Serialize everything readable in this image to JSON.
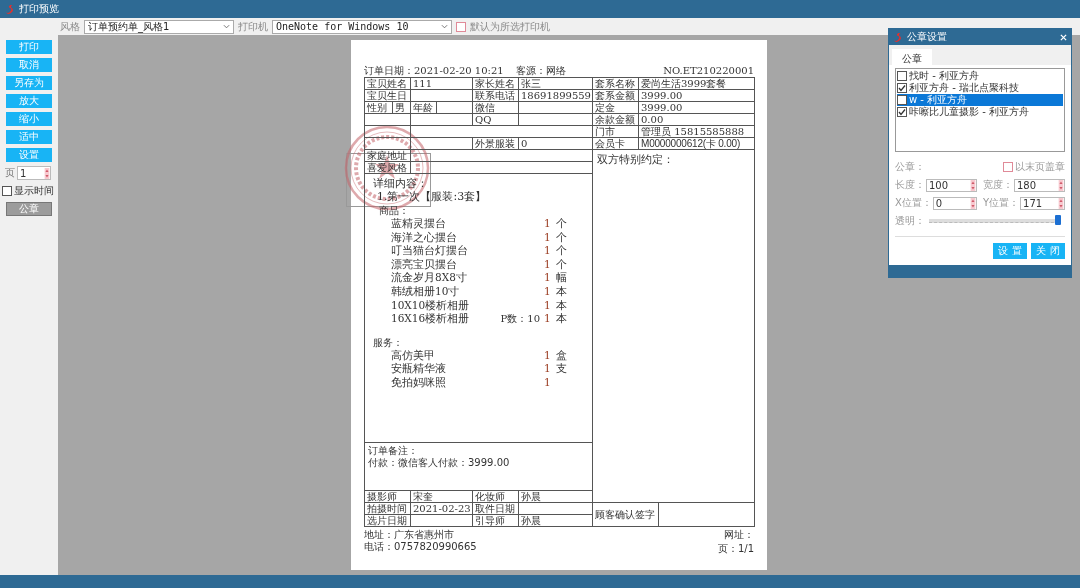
{
  "window": {
    "title": "打印预览"
  },
  "toolbar": {
    "style_label": "风格",
    "style_value": "订单预约单_风格1",
    "printer_label": "打印机",
    "printer_value": "OneNote for Windows 10",
    "default_printer": {
      "label": "默认为所选打印机",
      "checked": false
    }
  },
  "sidebar": {
    "buttons": [
      {
        "label": "打印"
      },
      {
        "label": "取消"
      },
      {
        "label": "另存为"
      },
      {
        "label": "放大"
      },
      {
        "label": "缩小"
      },
      {
        "label": "适中"
      },
      {
        "label": "设置"
      }
    ],
    "page": {
      "label": "页",
      "value": "1"
    },
    "show_time": {
      "label": "显示时间",
      "checked": false
    },
    "seal_button": "公章"
  },
  "document": {
    "header": {
      "order_date": "订单日期：2021-02-20 10:21",
      "source": "客源：网络",
      "number": "NO.ET210220001"
    },
    "info_rows": [
      {
        "kind": "four",
        "label1": "宝贝姓名",
        "value1": "111",
        "label2": "家长姓名",
        "value2": "张三"
      },
      {
        "kind": "four",
        "label1": "宝贝生日",
        "label2": "联系电话",
        "value2": "18691899559"
      },
      {
        "kind": "split",
        "label1": "性别",
        "sub1": "男",
        "mid": "年龄",
        "label2": "微信"
      },
      {
        "kind": "four",
        "label2": "QQ"
      },
      {
        "kind": "wide"
      },
      {
        "kind": "four",
        "label2": "外景服装",
        "value2": "0"
      },
      {
        "kind": "wide",
        "label1": "家庭地址"
      },
      {
        "kind": "wide",
        "label1": "喜爱风格"
      }
    ],
    "package_rows": [
      {
        "label": "套系名称",
        "value": "爱尚生活3999套餐"
      },
      {
        "label": "套系金额",
        "value": "3999.00"
      },
      {
        "label": "定金",
        "value": "3999.00"
      },
      {
        "label": "余款金额",
        "value": "0.00"
      },
      {
        "label": "门市",
        "value": "管理员  15815585888"
      },
      {
        "label": "会员卡",
        "value": "M0000000612(卡 0.00)",
        "kind": "small"
      }
    ],
    "details": {
      "title": "详细内容：",
      "package": "1.第一次【服装:3套】",
      "sections": [
        {
          "title": "商品：",
          "items": [
            {
              "name": "蓝精灵摆台",
              "qty": "1",
              "unit": "个"
            },
            {
              "name": "海洋之心摆台",
              "qty": "1",
              "unit": "个"
            },
            {
              "name": "叮当猫台灯摆台",
              "qty": "1",
              "unit": "个"
            },
            {
              "name": "漂亮宝贝摆台",
              "qty": "1",
              "unit": "个"
            },
            {
              "name": "流金岁月8X8寸",
              "qty": "1",
              "unit": "幅"
            },
            {
              "name": "韩绒相册10寸",
              "qty": "1",
              "unit": "本"
            },
            {
              "name": "10X10楼析相册",
              "qty": "1",
              "unit": "本"
            },
            {
              "name": "16X16楼析相册",
              "note": "P数：10",
              "qty": "1",
              "unit": "本"
            }
          ]
        },
        {
          "title": "服务：",
          "items": [
            {
              "name": "高仿美甲",
              "qty": "1",
              "unit": "盒"
            },
            {
              "name": "安瓶精华液",
              "qty": "1",
              "unit": "支"
            },
            {
              "name": "免拍妈咪照",
              "qty": "1"
            }
          ]
        }
      ]
    },
    "notes": {
      "title": "订单备注：",
      "text": "付款：微信客人付款：3999.00"
    },
    "agreement": "双方特别约定：",
    "staff_rows": [
      {
        "label1": "摄影师",
        "value1": "宋奎",
        "label2": "化妆师",
        "value2": "孙晨"
      },
      {
        "label1": "拍摄时间",
        "value1": "2021-02-23",
        "label2": "取件日期"
      },
      {
        "label1": "选片日期",
        "label2": "引导师",
        "value2": "孙晨"
      }
    ],
    "signature": "顾客确认签字",
    "footer": {
      "address": "地址：广东省惠州市",
      "phone": "电话：0757820990665",
      "website": "网址：",
      "page": "页：1/1"
    }
  },
  "dialog": {
    "title": "公章设置",
    "tabs": [
      {
        "label": "公章",
        "selected": true
      }
    ],
    "seals": [
      {
        "label": "找时 - 利亚方舟",
        "checked": false,
        "selected": false
      },
      {
        "label": "利亚方舟 - 瑞北点聚科技",
        "checked": true,
        "selected": false
      },
      {
        "label": "w - 利亚方舟",
        "checked": false,
        "selected": true
      },
      {
        "label": "咔嚓比儿童摄影 - 利亚方舟",
        "checked": true,
        "selected": false
      }
    ],
    "seal_label": "公章：",
    "last_page": {
      "label": "以末页盖章",
      "checked": false
    },
    "fields": [
      {
        "label": "长度：",
        "value": "100"
      },
      {
        "label": "宽度：",
        "value": "180"
      },
      {
        "label": "X位置：",
        "value": "0"
      },
      {
        "label": "Y位置：",
        "value": "171"
      }
    ],
    "opacity": {
      "label": "透明：",
      "level": 1
    },
    "buttons": [
      "设 置",
      "关 闭"
    ]
  }
}
